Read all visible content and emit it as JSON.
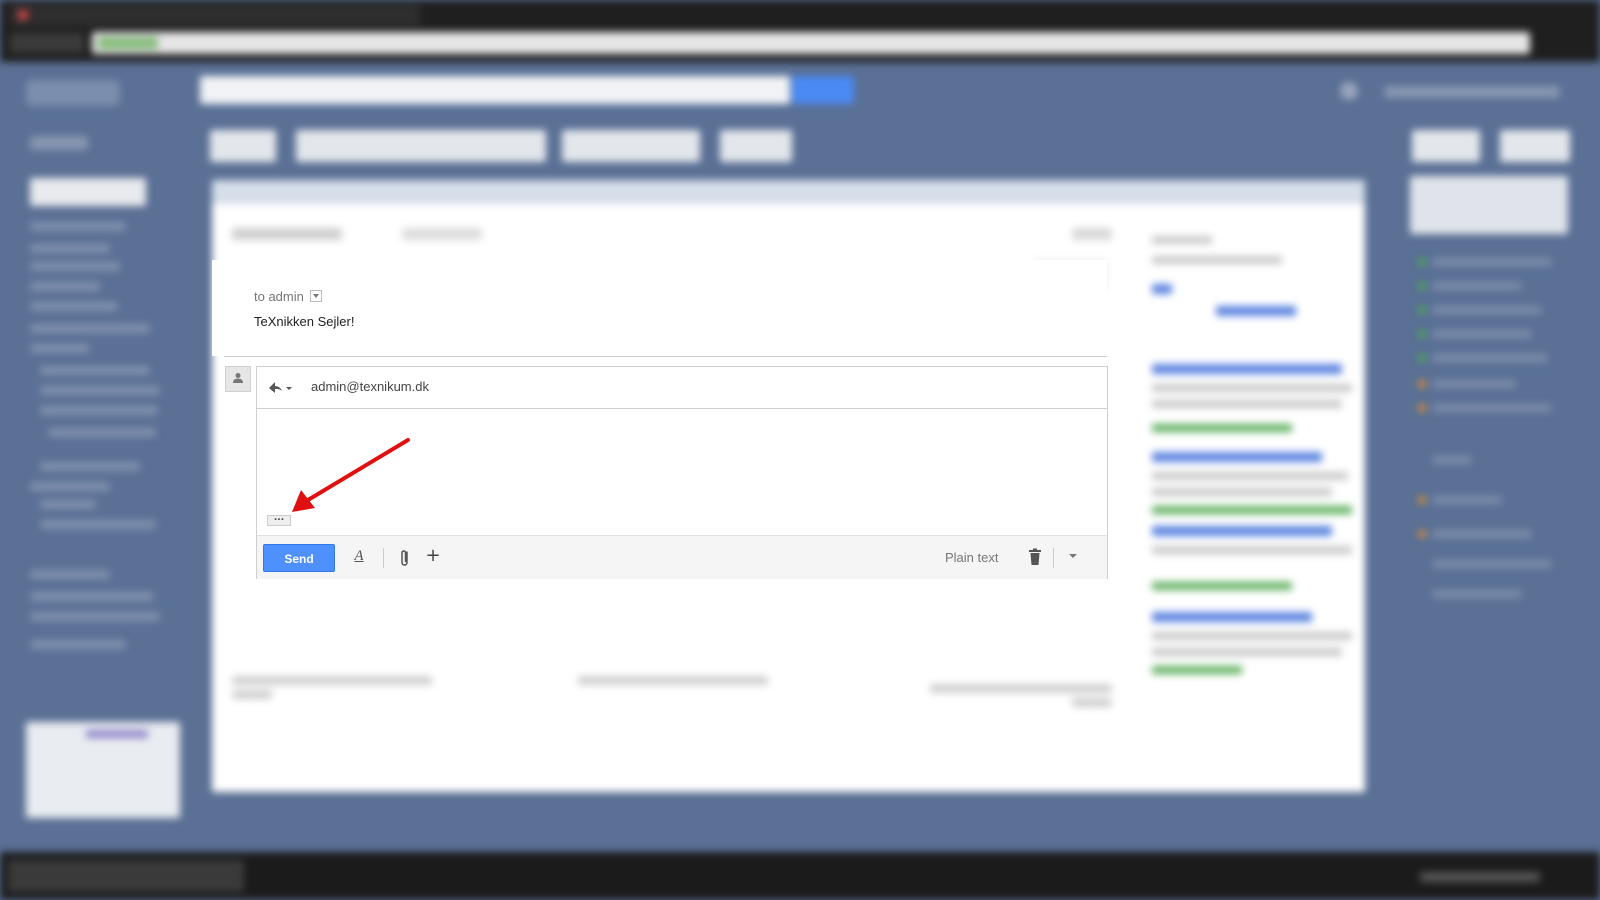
{
  "message": {
    "to_line": "to admin",
    "body": "TeXnikken Sejler!"
  },
  "reply": {
    "recipient": "admin@texnikum.dk",
    "trimmed_content": "...",
    "send_label": "Send",
    "plain_text_label": "Plain text",
    "more_label": "+",
    "format_label": "A"
  },
  "annotation": {
    "arrow_color": "#e01010"
  },
  "colors": {
    "send_button": "#4d90fe",
    "page_background": "#5a7095"
  },
  "icons": {
    "reply_type": "reply-icon",
    "attach": "paperclip-icon",
    "trash": "trash-icon",
    "options": "chevron-down-icon",
    "avatar": "person-icon"
  }
}
